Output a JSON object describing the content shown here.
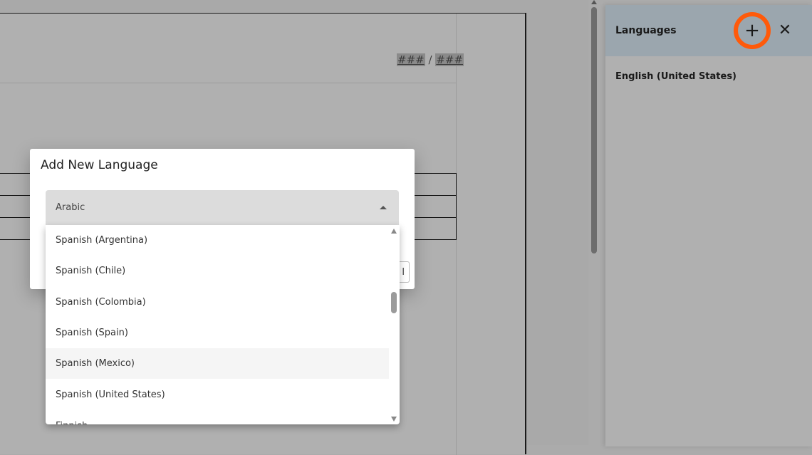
{
  "document": {
    "page_number_placeholder": "###",
    "page_number_separator": "/",
    "page_total_placeholder": "###"
  },
  "side_panel": {
    "title": "Languages",
    "add_icon": "plus-icon",
    "add_glyph": "+",
    "close_icon": "close-icon",
    "close_glyph": "✕",
    "highlight_color": "#ff5a0a",
    "languages": [
      "English (United States)"
    ]
  },
  "dialog": {
    "title": "Add New Language",
    "select": {
      "value": "Arabic",
      "arrow_icon": "caret-up-icon"
    },
    "partial_button_text": "l"
  },
  "dropdown": {
    "options": [
      "Spanish (Argentina)",
      "Spanish (Chile)",
      "Spanish (Colombia)",
      "Spanish (Spain)",
      "Spanish (Mexico)",
      "Spanish (United States)",
      "Finnish"
    ],
    "hovered": "Spanish (Mexico)"
  }
}
